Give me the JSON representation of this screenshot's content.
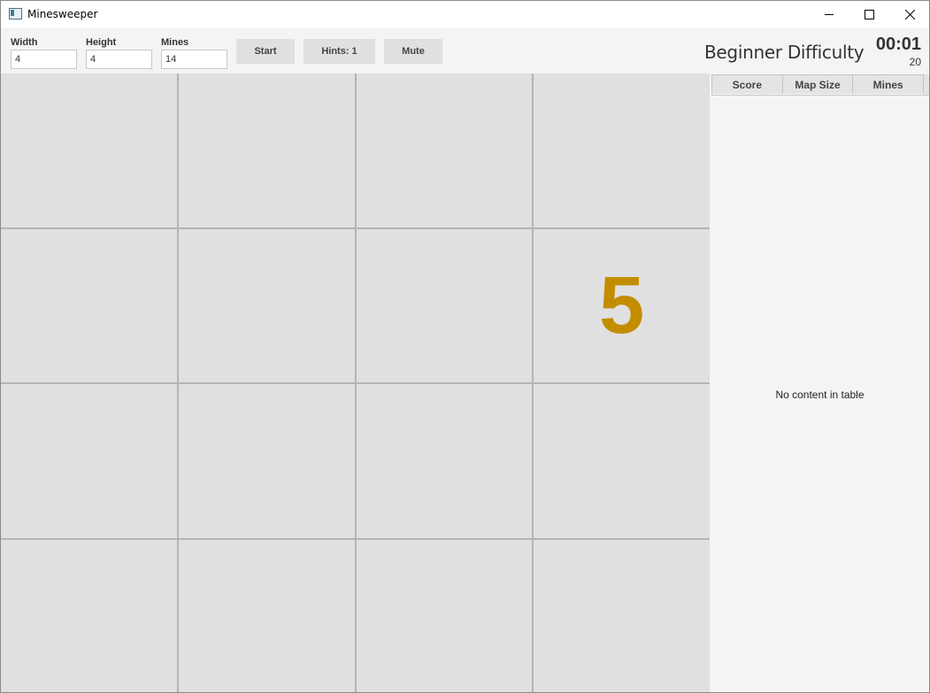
{
  "window": {
    "title": "Minesweeper",
    "icon": "app-window-icon"
  },
  "toolbar": {
    "width_label": "Width",
    "width_value": "4",
    "height_label": "Height",
    "height_value": "4",
    "mines_label": "Mines",
    "mines_value": "14",
    "start_label": "Start",
    "hints_label": "Hints: 1",
    "mute_label": "Mute",
    "difficulty": "Beginner Difficulty",
    "timer": "00:01",
    "counter": "20"
  },
  "board": {
    "columns": 4,
    "rows": 4,
    "cells": [
      "",
      "",
      "",
      "",
      "",
      "",
      "",
      "5",
      "",
      "",
      "",
      "",
      "",
      "",
      "",
      ""
    ],
    "number_color": "#c48d00"
  },
  "scores": {
    "columns": [
      "Score",
      "Map Size",
      "Mines"
    ],
    "empty_message": "No content in table"
  },
  "colors": {
    "cell": "#e0e0e0",
    "grid_line": "#b4b4b4",
    "button": "#e0e0e0"
  }
}
